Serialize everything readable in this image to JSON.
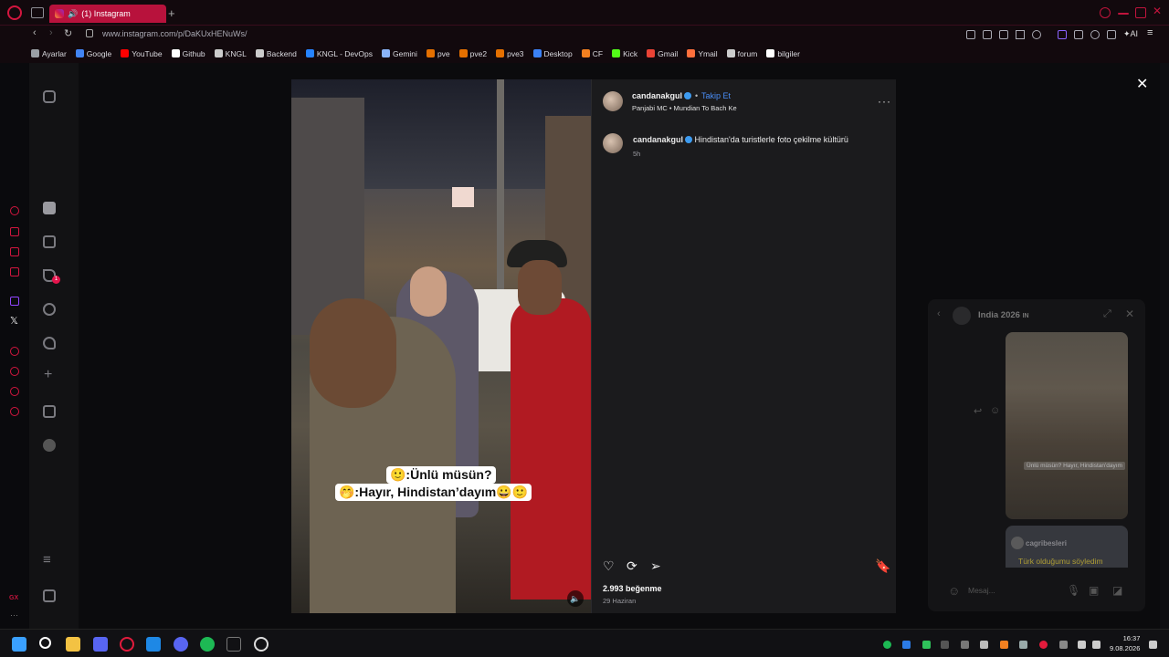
{
  "browser": {
    "tab_title": "(1) Instagram",
    "url": "www.instagram.com/p/DaKUxHENuWs/",
    "ai_label": "AI"
  },
  "bookmarks": [
    {
      "label": "Ayarlar",
      "icon": "gear-icon",
      "color": "#9aa0a6"
    },
    {
      "label": "Google",
      "icon": "google-icon",
      "color": "#4285f4"
    },
    {
      "label": "YouTube",
      "icon": "youtube-icon",
      "color": "#ff0000"
    },
    {
      "label": "Github",
      "icon": "github-icon",
      "color": "#ffffff"
    },
    {
      "label": "KNGL",
      "icon": "folder-icon",
      "color": "#cccccc"
    },
    {
      "label": "Backend",
      "icon": "folder-icon",
      "color": "#cccccc"
    },
    {
      "label": "KNGL - DevOps",
      "icon": "jira-icon",
      "color": "#2684ff"
    },
    {
      "label": "Gemini",
      "icon": "gemini-icon",
      "color": "#8ab4f8"
    },
    {
      "label": "pve",
      "icon": "proxmox-icon",
      "color": "#e57000"
    },
    {
      "label": "pve2",
      "icon": "proxmox-icon",
      "color": "#e57000"
    },
    {
      "label": "pve3",
      "icon": "proxmox-icon",
      "color": "#e57000"
    },
    {
      "label": "Desktop",
      "icon": "desktop-icon",
      "color": "#3b82f6"
    },
    {
      "label": "CF",
      "icon": "cloudflare-icon",
      "color": "#f38020"
    },
    {
      "label": "Kick",
      "icon": "kick-icon",
      "color": "#53fc18"
    },
    {
      "label": "Gmail",
      "icon": "gmail-icon",
      "color": "#ea4335"
    },
    {
      "label": "Ymail",
      "icon": "ymail-icon",
      "color": "#ff6f3c"
    },
    {
      "label": "forum",
      "icon": "forum-icon",
      "color": "#cccccc"
    },
    {
      "label": "bilgiler",
      "icon": "github-icon",
      "color": "#ffffff"
    }
  ],
  "post": {
    "username": "candanakgul",
    "follow_label": "Takip Et",
    "audio": "Panjabi MC • Mundian To Bach Ke",
    "caption": "Hindistan'da turistlerle foto çekilme kültürü",
    "time": "5h",
    "likes": "2.993 beğenme",
    "date": "29 Haziran",
    "overlay_line1": "🙂:Ünlü müsün?",
    "overlay_line2": "🤭:Hayır, Hindistan’dayım😀🙂"
  },
  "chat": {
    "title": "India 2026",
    "title_suffix": "IN",
    "thumb_caption": "Ünlü müsün? Hayır, Hindistan'dayım",
    "card_user": "cagribesleri",
    "card_message": "Türk olduğumu söyledim",
    "input_placeholder": "Mesaj..."
  },
  "taskbar": {
    "time": "16:37",
    "date": "9.08.2026"
  }
}
